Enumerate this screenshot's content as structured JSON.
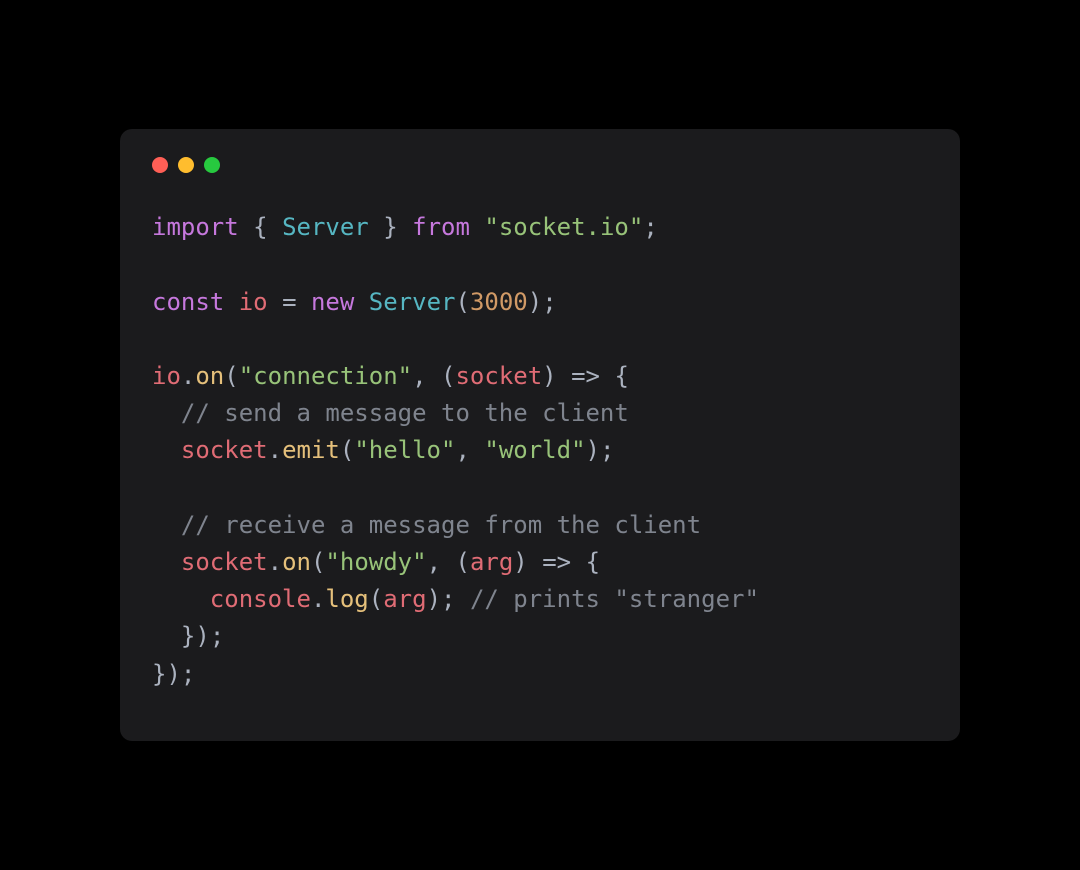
{
  "code": {
    "tokens": [
      {
        "t": "import",
        "c": "keyword"
      },
      {
        "t": " ",
        "c": "plain"
      },
      {
        "t": "{",
        "c": "punct"
      },
      {
        "t": " ",
        "c": "plain"
      },
      {
        "t": "Server",
        "c": "class"
      },
      {
        "t": " ",
        "c": "plain"
      },
      {
        "t": "}",
        "c": "punct"
      },
      {
        "t": " ",
        "c": "plain"
      },
      {
        "t": "from",
        "c": "keyword"
      },
      {
        "t": " ",
        "c": "plain"
      },
      {
        "t": "\"socket.io\"",
        "c": "string"
      },
      {
        "t": ";",
        "c": "punct"
      },
      {
        "t": "\n\n",
        "c": "plain"
      },
      {
        "t": "const",
        "c": "keyword"
      },
      {
        "t": " ",
        "c": "plain"
      },
      {
        "t": "io",
        "c": "ident"
      },
      {
        "t": " ",
        "c": "plain"
      },
      {
        "t": "=",
        "c": "op"
      },
      {
        "t": " ",
        "c": "plain"
      },
      {
        "t": "new",
        "c": "keyword"
      },
      {
        "t": " ",
        "c": "plain"
      },
      {
        "t": "Server",
        "c": "class"
      },
      {
        "t": "(",
        "c": "punct"
      },
      {
        "t": "3000",
        "c": "number"
      },
      {
        "t": ")",
        "c": "punct"
      },
      {
        "t": ";",
        "c": "punct"
      },
      {
        "t": "\n\n",
        "c": "plain"
      },
      {
        "t": "io",
        "c": "ident"
      },
      {
        "t": ".",
        "c": "punct"
      },
      {
        "t": "on",
        "c": "func"
      },
      {
        "t": "(",
        "c": "punct"
      },
      {
        "t": "\"connection\"",
        "c": "string"
      },
      {
        "t": ",",
        "c": "punct"
      },
      {
        "t": " ",
        "c": "plain"
      },
      {
        "t": "(",
        "c": "punct"
      },
      {
        "t": "socket",
        "c": "ident"
      },
      {
        "t": ")",
        "c": "punct"
      },
      {
        "t": " ",
        "c": "plain"
      },
      {
        "t": "=>",
        "c": "op"
      },
      {
        "t": " ",
        "c": "plain"
      },
      {
        "t": "{",
        "c": "punct"
      },
      {
        "t": "\n",
        "c": "plain"
      },
      {
        "t": "  ",
        "c": "plain"
      },
      {
        "t": "// send a message to the client",
        "c": "comment"
      },
      {
        "t": "\n",
        "c": "plain"
      },
      {
        "t": "  ",
        "c": "plain"
      },
      {
        "t": "socket",
        "c": "ident"
      },
      {
        "t": ".",
        "c": "punct"
      },
      {
        "t": "emit",
        "c": "func"
      },
      {
        "t": "(",
        "c": "punct"
      },
      {
        "t": "\"hello\"",
        "c": "string"
      },
      {
        "t": ",",
        "c": "punct"
      },
      {
        "t": " ",
        "c": "plain"
      },
      {
        "t": "\"world\"",
        "c": "string"
      },
      {
        "t": ")",
        "c": "punct"
      },
      {
        "t": ";",
        "c": "punct"
      },
      {
        "t": "\n\n",
        "c": "plain"
      },
      {
        "t": "  ",
        "c": "plain"
      },
      {
        "t": "// receive a message from the client",
        "c": "comment"
      },
      {
        "t": "\n",
        "c": "plain"
      },
      {
        "t": "  ",
        "c": "plain"
      },
      {
        "t": "socket",
        "c": "ident"
      },
      {
        "t": ".",
        "c": "punct"
      },
      {
        "t": "on",
        "c": "func"
      },
      {
        "t": "(",
        "c": "punct"
      },
      {
        "t": "\"howdy\"",
        "c": "string"
      },
      {
        "t": ",",
        "c": "punct"
      },
      {
        "t": " ",
        "c": "plain"
      },
      {
        "t": "(",
        "c": "punct"
      },
      {
        "t": "arg",
        "c": "ident"
      },
      {
        "t": ")",
        "c": "punct"
      },
      {
        "t": " ",
        "c": "plain"
      },
      {
        "t": "=>",
        "c": "op"
      },
      {
        "t": " ",
        "c": "plain"
      },
      {
        "t": "{",
        "c": "punct"
      },
      {
        "t": "\n",
        "c": "plain"
      },
      {
        "t": "    ",
        "c": "plain"
      },
      {
        "t": "console",
        "c": "ident"
      },
      {
        "t": ".",
        "c": "punct"
      },
      {
        "t": "log",
        "c": "func"
      },
      {
        "t": "(",
        "c": "punct"
      },
      {
        "t": "arg",
        "c": "ident"
      },
      {
        "t": ")",
        "c": "punct"
      },
      {
        "t": ";",
        "c": "punct"
      },
      {
        "t": " ",
        "c": "plain"
      },
      {
        "t": "// prints \"stranger\"",
        "c": "comment"
      },
      {
        "t": "\n",
        "c": "plain"
      },
      {
        "t": "  ",
        "c": "plain"
      },
      {
        "t": "}",
        "c": "punct"
      },
      {
        "t": ")",
        "c": "punct"
      },
      {
        "t": ";",
        "c": "punct"
      },
      {
        "t": "\n",
        "c": "plain"
      },
      {
        "t": "}",
        "c": "punct"
      },
      {
        "t": ")",
        "c": "punct"
      },
      {
        "t": ";",
        "c": "punct"
      }
    ]
  }
}
